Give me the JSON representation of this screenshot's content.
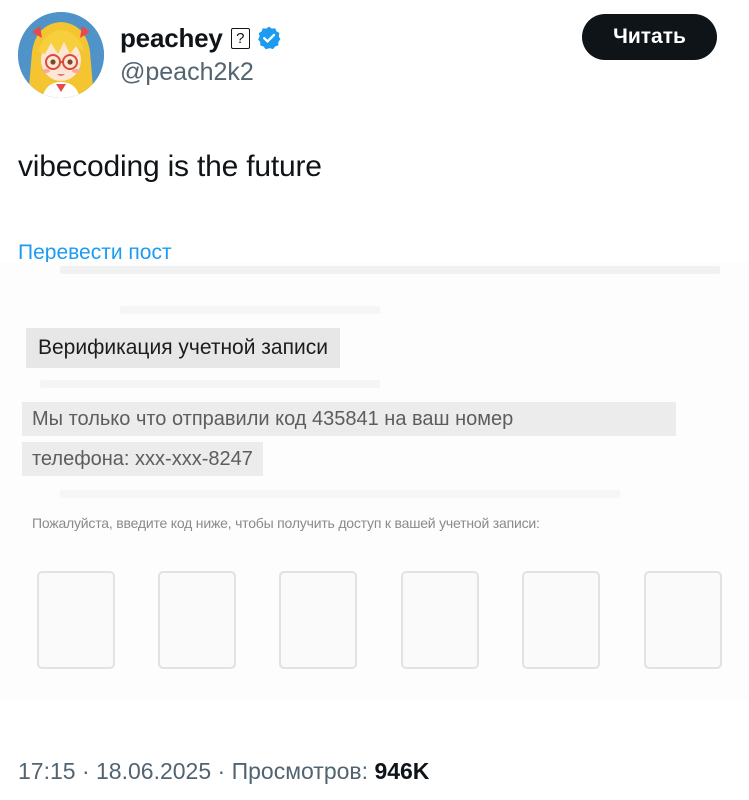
{
  "author": {
    "display_name": "peachey",
    "help_badge": "?",
    "handle": "@peach2k2",
    "avatar_icon": "anime-girl-avatar",
    "verified_icon": "verified-badge-icon",
    "verified_color": "#1d9bf0"
  },
  "follow_button": {
    "label": "Читать"
  },
  "post": {
    "text": "vibecoding is the future",
    "translate_label": "Перевести пост"
  },
  "image": {
    "heading": "Верификация учетной записи",
    "sent_line_1": "Мы только что отправили код 435841 на ваш номер",
    "sent_line_2": "телефона: xxx-xxx-8247",
    "instruction": "Пожалуйста, введите код ниже, чтобы получить доступ к вашей учетной записи:",
    "code_boxes": [
      "",
      "",
      "",
      "",
      "",
      ""
    ]
  },
  "meta": {
    "time": "17:15",
    "separator": " · ",
    "date": "18.06.2025",
    "views_label": "Просмотров:",
    "views_count": "946K"
  },
  "colors": {
    "text": "#0f1419",
    "secondary": "#536471",
    "link": "#1d9bf0",
    "button_bg": "#0f1419"
  }
}
